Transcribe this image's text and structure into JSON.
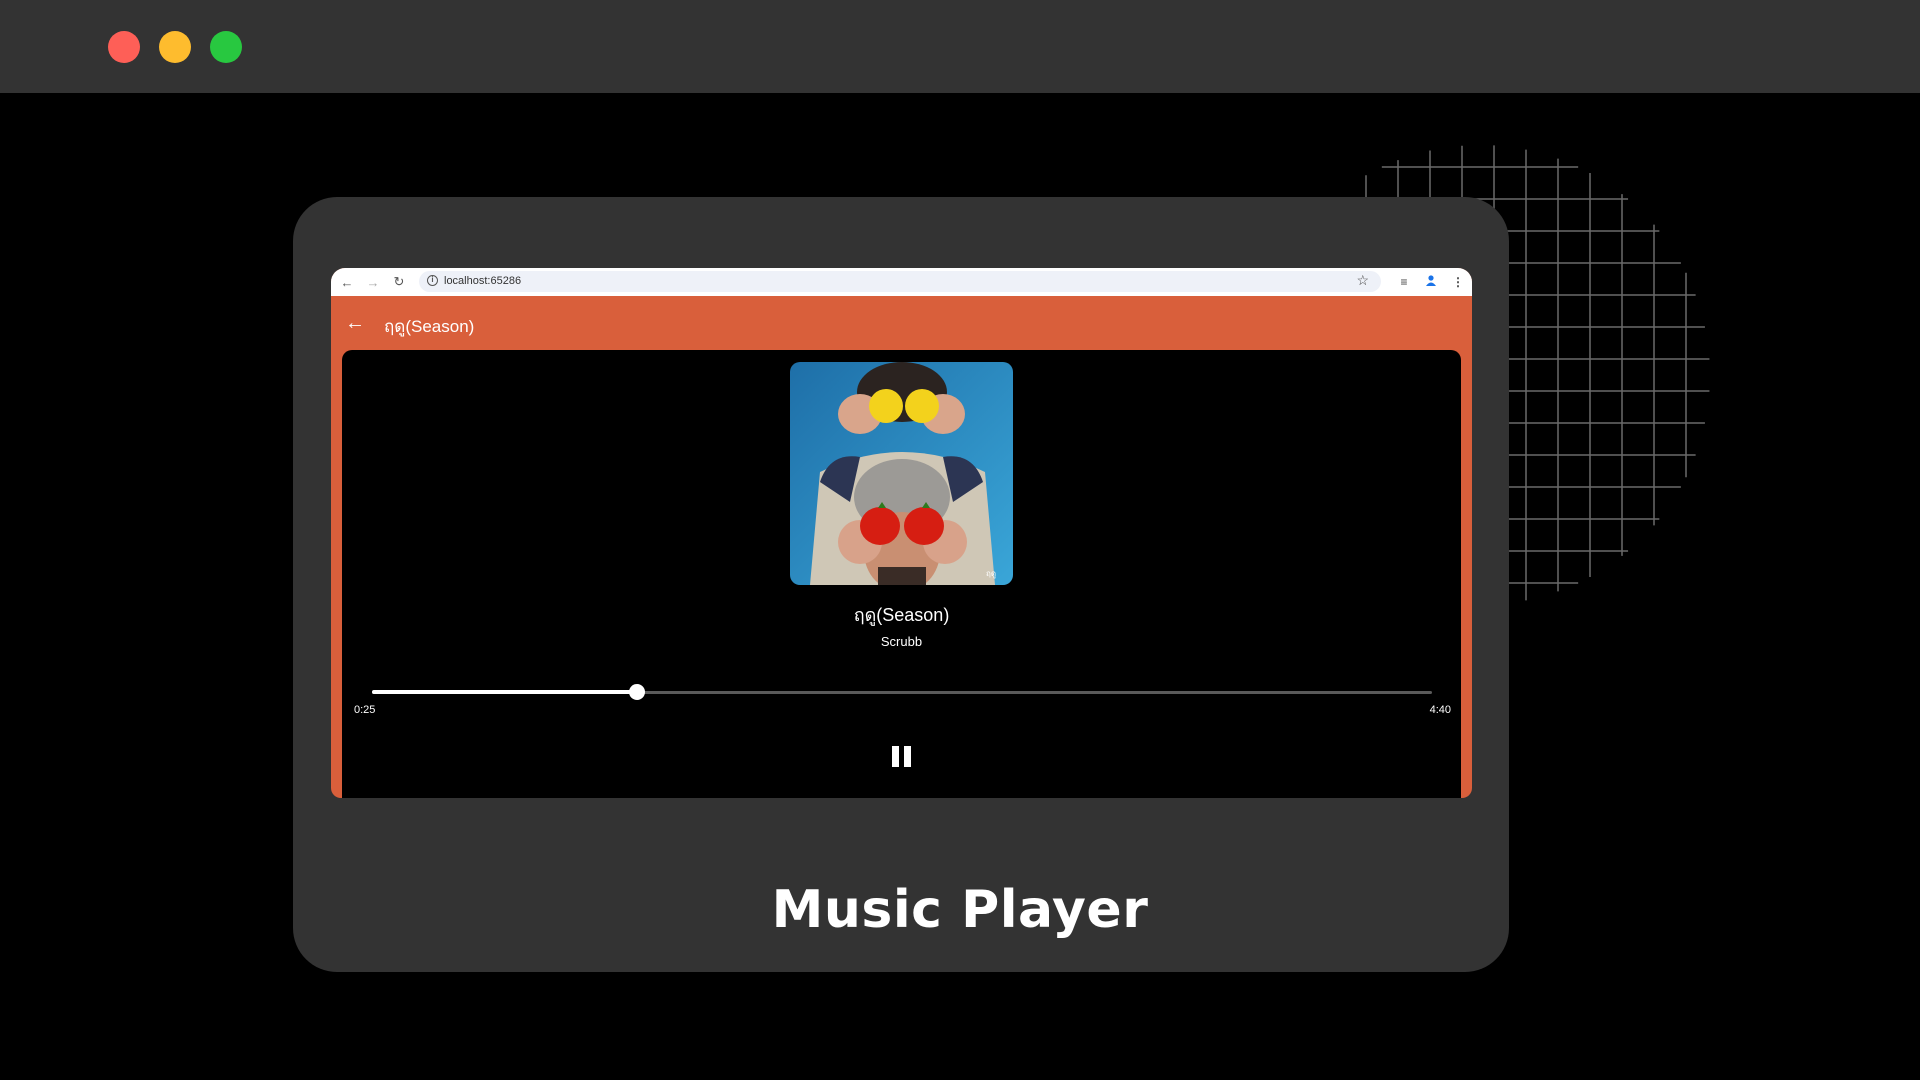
{
  "window": {
    "controls": [
      "close",
      "minimize",
      "maximize"
    ],
    "colors": {
      "close": "#fe5f57",
      "minimize": "#febc2e",
      "maximize": "#28c840"
    }
  },
  "browser": {
    "url": "localhost:65286",
    "icons": [
      "back-icon",
      "forward-icon",
      "reload-icon",
      "info-icon",
      "star-icon",
      "media-control-icon",
      "profile-icon",
      "more-icon"
    ]
  },
  "app": {
    "title": "ฤดู(Season)",
    "accent_color": "#d95f3b"
  },
  "player": {
    "song_title": "ฤดู(Season)",
    "artist": "Scrubb",
    "current_time": "0:25",
    "total_time": "4:40",
    "progress": 0.25,
    "state": "playing"
  },
  "caption": "Music Player"
}
